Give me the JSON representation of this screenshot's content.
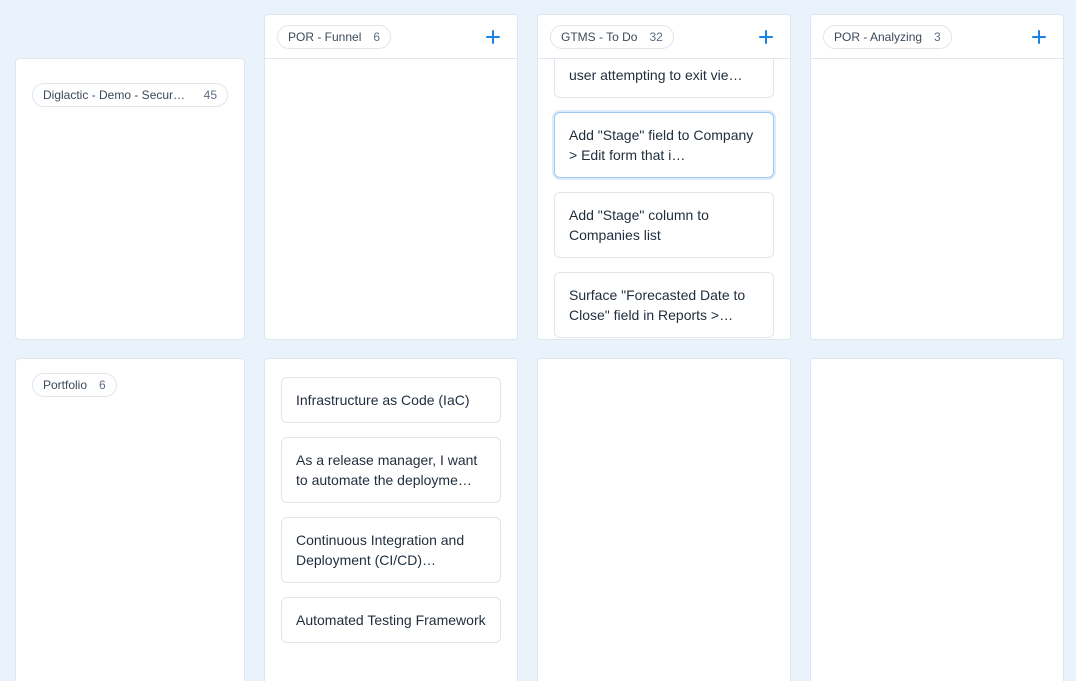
{
  "panels": {
    "diglactic": {
      "label": "Diglactic - Demo - Secure Paym…",
      "count": 45
    },
    "porFunnel": {
      "label": "POR - Funnel",
      "count": 6
    },
    "gtms": {
      "label": "GTMS - To Do",
      "count": 32,
      "cards": [
        "user attempting to exit vie…",
        "Add \"Stage\" field to Company > Edit form that i…",
        "Add \"Stage\" column to Companies list",
        "Surface \"Forecasted Date to Close\" field in Reports >…"
      ]
    },
    "porAnalyzing": {
      "label": "POR - Analyzing",
      "count": 3
    },
    "portfolio": {
      "label": "Portfolio",
      "count": 6
    },
    "col2bottom": {
      "cards": [
        "Infrastructure as Code (IaC)",
        "As a release manager, I want to automate the deployme…",
        "Continuous Integration and Deployment (CI/CD)…",
        "Automated Testing Framework"
      ]
    }
  }
}
